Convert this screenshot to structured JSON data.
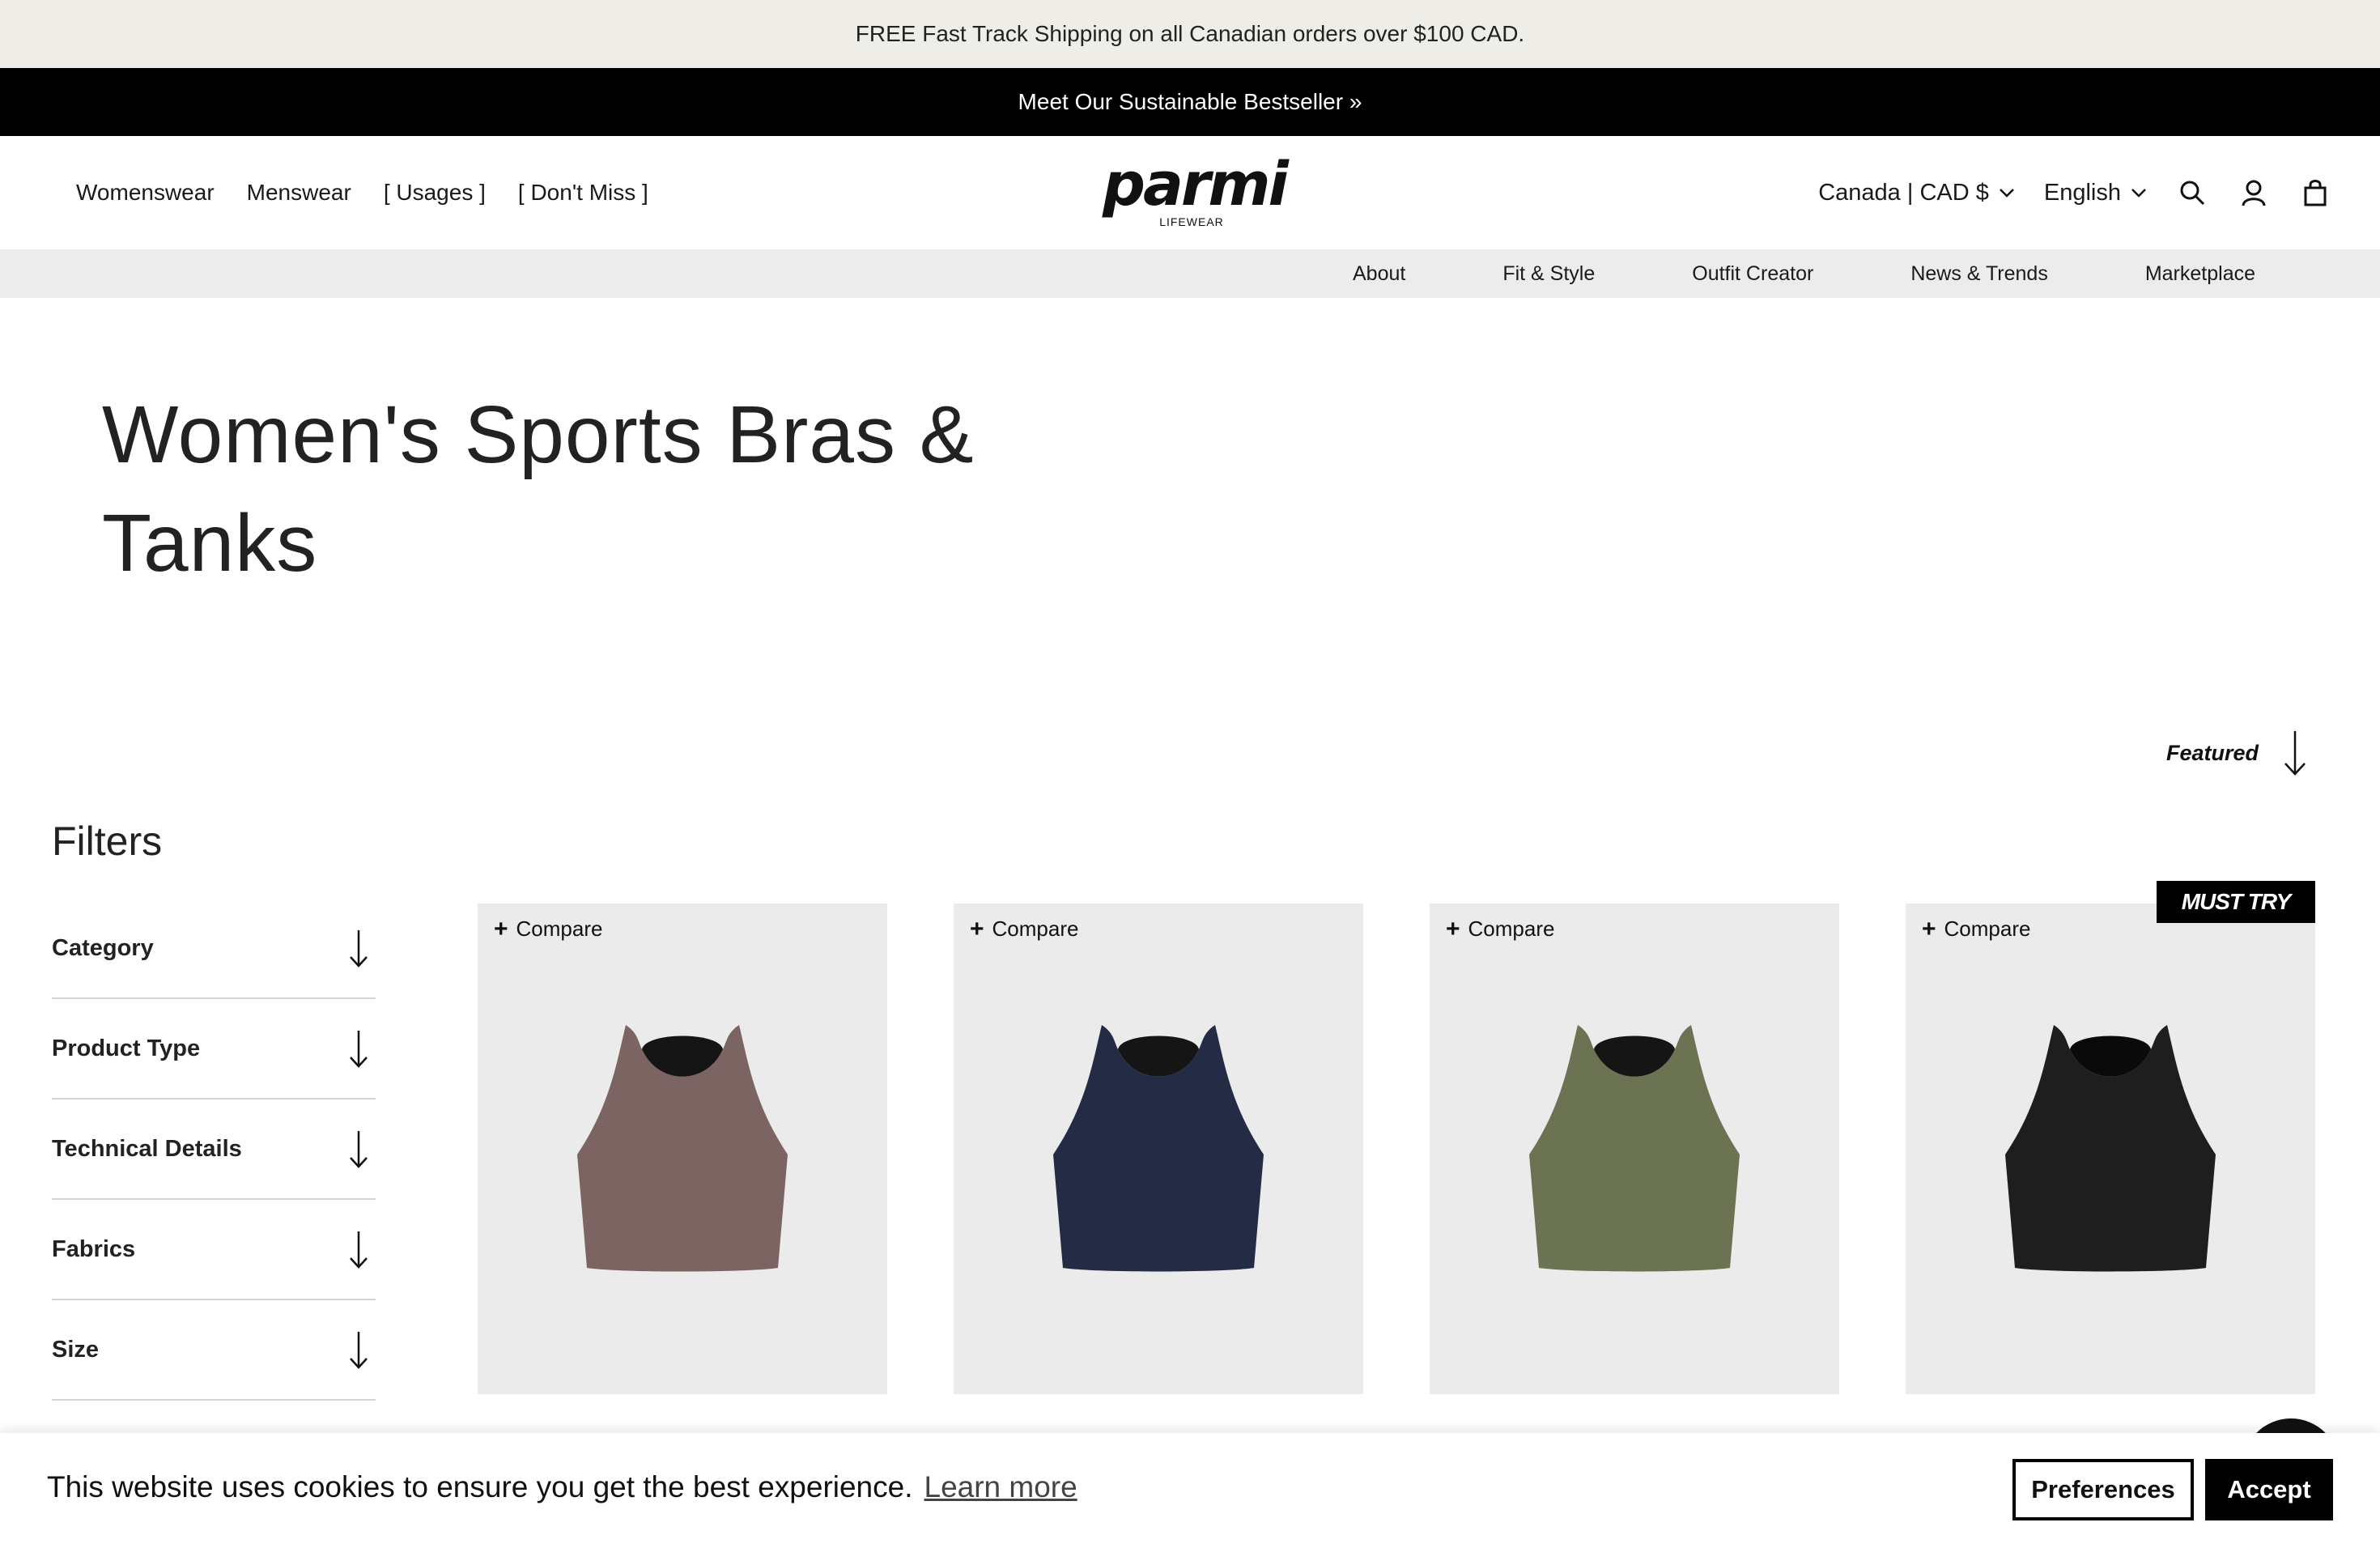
{
  "announcement": {
    "text": "FREE Fast Track Shipping on all Canadian orders over $100 CAD."
  },
  "promo_bar": {
    "text": "Meet Our Sustainable Bestseller »"
  },
  "header": {
    "main_nav": [
      "Womenswear",
      "Menswear",
      "[ Usages ]",
      "[ Don't Miss ]"
    ],
    "logo": {
      "wordmark": "parmi",
      "tagline": "LIFEWEAR"
    },
    "region_label": "Canada | CAD $",
    "language_label": "English",
    "icons": [
      "search-icon",
      "account-icon",
      "cart-icon"
    ]
  },
  "subnav": [
    "About",
    "Fit & Style",
    "Outfit Creator",
    "News & Trends",
    "Marketplace"
  ],
  "page": {
    "title_line1": "Women's Sports Bras &",
    "title_line2": "Tanks"
  },
  "sort": {
    "label": "Featured"
  },
  "filters": {
    "title": "Filters",
    "items": [
      "Category",
      "Product Type",
      "Technical Details",
      "Fabrics",
      "Size"
    ]
  },
  "products": [
    {
      "compare_label": "Compare",
      "color": "#7c6462",
      "badge": ""
    },
    {
      "compare_label": "Compare",
      "color": "#232b45",
      "badge": ""
    },
    {
      "compare_label": "Compare",
      "color": "#6b7352",
      "badge": ""
    },
    {
      "compare_label": "Compare",
      "color": "#1e1e1e",
      "badge": "MUST TRY"
    }
  ],
  "cookie_banner": {
    "message": "This website uses cookies to ensure you get the best experience.",
    "learn_more": "Learn more",
    "preferences_label": "Preferences",
    "accept_label": "Accept"
  }
}
